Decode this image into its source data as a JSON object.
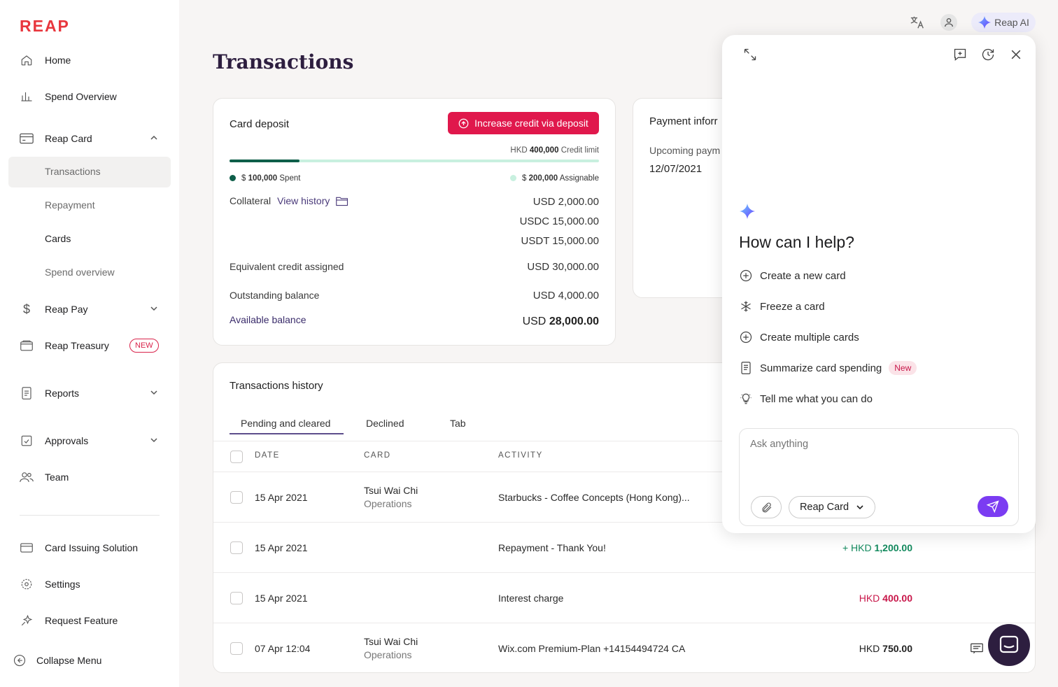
{
  "sidebar": {
    "logo": "REAP",
    "items": [
      {
        "label": "Home",
        "icon": "home-icon"
      },
      {
        "label": "Spend Overview",
        "icon": "bar-chart-icon"
      },
      {
        "label": "Reap Card",
        "icon": "card-icon"
      },
      {
        "label": "Reap Pay",
        "icon": "dollar-icon"
      },
      {
        "label": "Reap Treasury",
        "icon": "wallet-icon",
        "badge": "NEW"
      },
      {
        "label": "Reports",
        "icon": "report-icon"
      },
      {
        "label": "Approvals",
        "icon": "approval-icon"
      },
      {
        "label": "Team",
        "icon": "team-icon"
      },
      {
        "label": "Card Issuing Solution",
        "icon": "card-stack-icon"
      },
      {
        "label": "Settings",
        "icon": "gear-icon"
      },
      {
        "label": "Request Feature",
        "icon": "sparkle-icon"
      },
      {
        "label": "Collapse Menu",
        "icon": "collapse-icon"
      }
    ],
    "subitems": [
      "Transactions",
      "Repayment",
      "Cards",
      "Spend overview"
    ]
  },
  "page": {
    "title": "Transactions"
  },
  "topbar": {
    "ai_label": "Reap AI"
  },
  "deposit": {
    "title": "Card deposit",
    "button": "Increase credit via deposit",
    "credit_limit_prefix": "HKD",
    "credit_limit_value": "400,000",
    "credit_limit_suffix": "Credit limit",
    "spent_ratio": 0.19,
    "spent_prefix": "$",
    "spent_value": "100,000",
    "spent_suffix": "Spent",
    "assignable_prefix": "$",
    "assignable_value": "200,000",
    "assignable_suffix": "Assignable",
    "collateral_label": "Collateral",
    "view_history": "View history",
    "collateral_values": [
      "USD 2,000.00",
      "USDC 15,000.00",
      "USDT 15,000.00"
    ],
    "equiv_label": "Equivalent credit assigned",
    "equiv_value": "USD 30,000.00",
    "outstanding_label": "Outstanding balance",
    "outstanding_value": "USD 4,000.00",
    "available_label": "Available balance",
    "available_currency": "USD",
    "available_value": "28,000.00"
  },
  "payment": {
    "title": "Payment inforr",
    "upcoming_label": "Upcoming paym",
    "upcoming_date": "12/07/2021"
  },
  "history": {
    "title": "Transactions history",
    "tabs": [
      "Pending and cleared",
      "Declined",
      "Tab"
    ],
    "columns": [
      "DATE",
      "CARD",
      "ACTIVITY"
    ],
    "rows": [
      {
        "date": "15 Apr 2021",
        "card_name": "Tsui Wai Chi",
        "card_team": "Operations",
        "activity": "Starbucks - Coffee Concepts (Hong Kong)...",
        "amount_prefix": "",
        "amount_value": ""
      },
      {
        "date": "15 Apr 2021",
        "card_name": "",
        "card_team": "",
        "activity": "Repayment - Thank You!",
        "amount_prefix": "+ HKD",
        "amount_value": "1,200.00"
      },
      {
        "date": "15 Apr 2021",
        "card_name": "",
        "card_team": "",
        "activity": "Interest charge",
        "amount_prefix": "HKD",
        "amount_value": "400.00"
      },
      {
        "date": "07 Apr 12:04",
        "card_name": "Tsui Wai Chi",
        "card_team": "Operations",
        "activity": "Wix.com Premium-Plan +14154494724 CA",
        "amount_prefix": "HKD",
        "amount_value": "750.00"
      }
    ]
  },
  "ai_panel": {
    "heading": "How can I help?",
    "suggestions": [
      {
        "label": "Create a new card",
        "icon": "plus-circle-icon"
      },
      {
        "label": "Freeze a card",
        "icon": "snowflake-icon"
      },
      {
        "label": "Create multiple cards",
        "icon": "plus-circle-icon"
      },
      {
        "label": "Summarize card spending",
        "icon": "document-icon",
        "badge": "New"
      },
      {
        "label": "Tell me what you can do",
        "icon": "lightbulb-icon"
      }
    ],
    "input_placeholder": "Ask anything",
    "context_select": "Reap Card"
  },
  "colors": {
    "brand": "#e8363d",
    "accent": "#7b4dff",
    "positive": "#138a5e",
    "negative": "#c8174a"
  }
}
